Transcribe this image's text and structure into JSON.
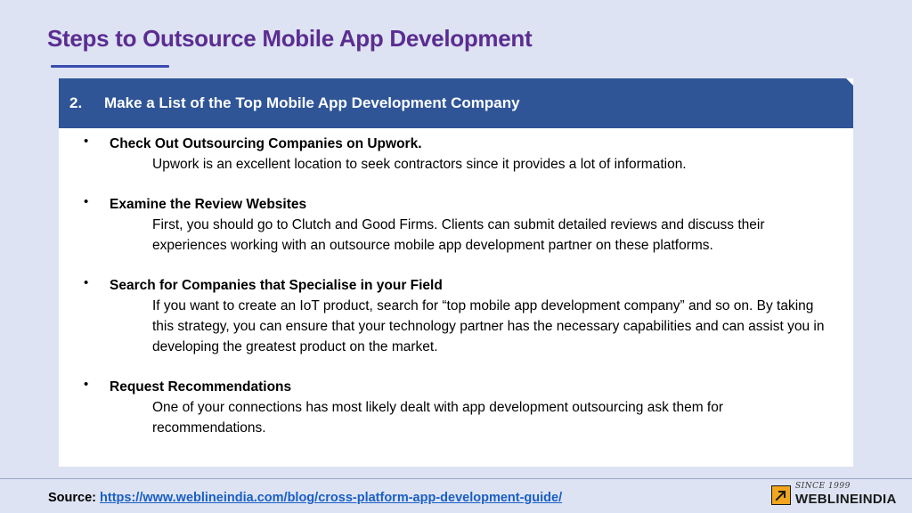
{
  "slide": {
    "title": "Steps to Outsource Mobile App Development"
  },
  "card": {
    "number": "2.",
    "heading": "Make a List of the Top Mobile App Development Company",
    "bullet_glyph": "•",
    "items": [
      {
        "title": "Check Out Outsourcing Companies on Upwork.",
        "body": "Upwork is an excellent location to seek contractors since it provides a lot of information."
      },
      {
        "title": "Examine the Review Websites",
        "body": "First, you should go to Clutch and Good Firms. Clients can submit detailed reviews and discuss their experiences working with an outsource mobile app development partner on these platforms."
      },
      {
        "title": "Search for Companies that Specialise in your Field",
        "body": "If you want to create an IoT product, search for “top mobile app development company” and so on. By taking this strategy, you can ensure that your technology partner has the necessary capabilities and can assist you in developing the greatest product on the market."
      },
      {
        "title": "Request Recommendations",
        "body": "One of your connections has most likely dealt with app development outsourcing ask them for recommendations."
      }
    ]
  },
  "footer": {
    "source_label": "Source:",
    "source_url": "https://www.weblineindia.com/blog/cross-platform-app-development-guide/"
  },
  "logo": {
    "since": "SINCE 1999",
    "name": "WEBLINEINDIA",
    "icon": "arrow-up-right-icon"
  },
  "colors": {
    "background": "#dde3f3",
    "title": "#5b2d91",
    "header_bar": "#2f5597",
    "link": "#1a5fc4",
    "logo_accent": "#f2a61d"
  }
}
